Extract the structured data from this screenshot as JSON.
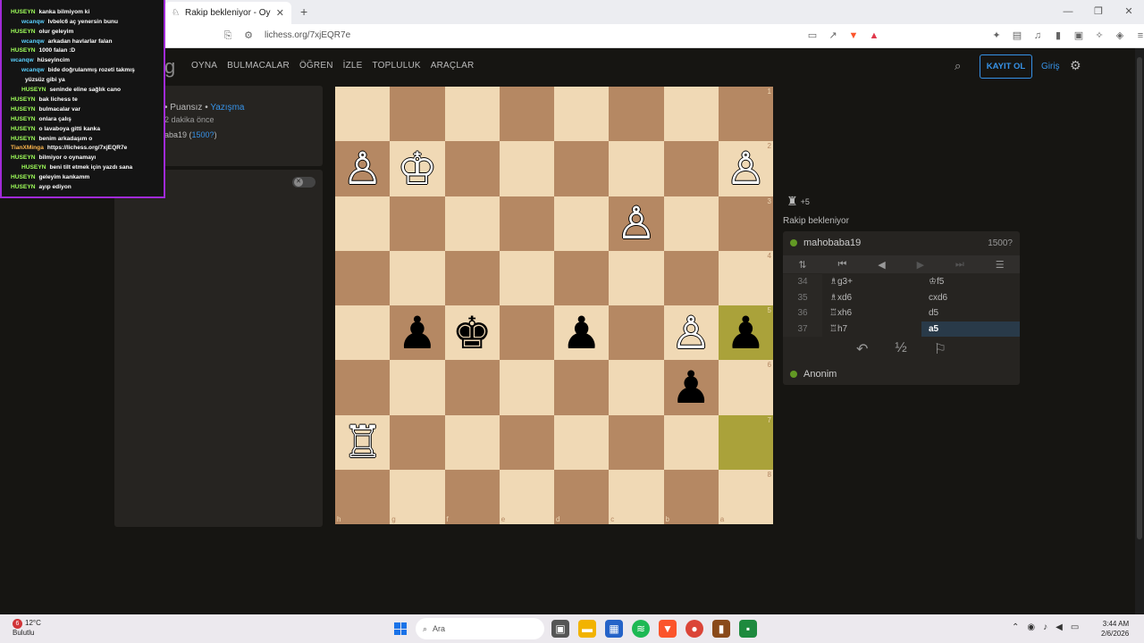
{
  "browser": {
    "tab_title": "Rakip bekleniyor - Oyna mah",
    "tab_close": "✕",
    "new_tab": "+",
    "url": "lichess.org/7xjEQR7e",
    "window_controls": [
      "—",
      "❐",
      "✕"
    ]
  },
  "site": {
    "logo_fragment": "g",
    "nav": [
      "OYNA",
      "BULMACALAR",
      "ÖĞREN",
      "İZLE",
      "TOPLULUK",
      "ARAÇLAR"
    ],
    "signup_label": "KAYIT OL",
    "signin_label": "Giriş"
  },
  "game_info": {
    "line1_prefix": "• Puansız •",
    "line1_link": "Yazışma",
    "line2": "2 dakika önce",
    "player_name": "aba19 (",
    "player_rating": "1500?",
    "player_close": ")"
  },
  "board": {
    "orientation": "black",
    "ranks": [
      "1",
      "2",
      "3",
      "4",
      "5",
      "6",
      "7",
      "8"
    ],
    "files": [
      "h",
      "g",
      "f",
      "e",
      "d",
      "c",
      "b",
      "a"
    ],
    "pieces": [
      [
        "",
        "",
        "",
        "",
        "",
        "",
        "",
        ""
      ],
      [
        "♙w",
        "♔w",
        "",
        "",
        "",
        "",
        "",
        "♙w"
      ],
      [
        "",
        "",
        "",
        "",
        "",
        "♙w",
        "",
        ""
      ],
      [
        "",
        "",
        "",
        "",
        "",
        "",
        "",
        ""
      ],
      [
        "",
        "♟b",
        "♚b",
        "",
        "♟b",
        "",
        "♙w",
        "♟b"
      ],
      [
        "",
        "",
        "",
        "",
        "",
        "",
        "♟b",
        ""
      ],
      [
        "♖w",
        "",
        "",
        "",
        "",
        "",
        "",
        ""
      ],
      [
        "",
        "",
        "",
        "",
        "",
        "",
        "",
        ""
      ]
    ],
    "highlights": [
      "4-7",
      "6-7"
    ]
  },
  "right_panel": {
    "material_diff": "+5",
    "status": "Rakip bekleniyor",
    "top_player": "mahobaba19",
    "top_rating": "1500?",
    "bottom_player": "Anonim",
    "moves": [
      {
        "num": "34",
        "white": "♗g3+",
        "black": "♔f5"
      },
      {
        "num": "35",
        "white": "♗xd6",
        "black": "cxd6"
      },
      {
        "num": "36",
        "white": "♖xh6",
        "black": "d5"
      },
      {
        "num": "37",
        "white": "♖h7",
        "black": "a5"
      }
    ],
    "action_half": "½"
  },
  "chat_overlay": [
    {
      "user": "HUSEYN",
      "color": "g",
      "text": "kanka bilmiyom ki"
    },
    {
      "user": "wcanqw",
      "color": "b",
      "text": "lvbelc6 aç yenersin bunu",
      "indent": true
    },
    {
      "user": "HUSEYN",
      "color": "g",
      "text": "olur geleyim"
    },
    {
      "user": "wcanqw",
      "color": "b",
      "text": "arkadan havlarlar falan",
      "indent": true
    },
    {
      "user": "HUSEYN",
      "color": "g",
      "text": "1000 falan :D"
    },
    {
      "user": "wcanqw",
      "color": "b",
      "text": "hüseyincim"
    },
    {
      "user": "wcanqw",
      "color": "b",
      "text": "bide doğrulanmış rozeti takmış",
      "indent": true
    },
    {
      "user": "",
      "color": "b",
      "text": "yüzsüz gibi ya",
      "indent": true
    },
    {
      "user": "HUSEYN",
      "color": "g",
      "text": "seninde eline sağlık cano",
      "indent": true
    },
    {
      "user": "HUSEYN",
      "color": "g",
      "text": "bak lichess te"
    },
    {
      "user": "HUSEYN",
      "color": "g",
      "text": "bulmacalar var"
    },
    {
      "user": "HUSEYN",
      "color": "g",
      "text": "onlara çalış"
    },
    {
      "user": "HUSEYN",
      "color": "g",
      "text": "o lavaboya gitti kanka"
    },
    {
      "user": "HUSEYN",
      "color": "g",
      "text": "benim arkadaşım o"
    },
    {
      "user": "TianXMinga",
      "color": "o",
      "text": "https://lichess.org/7xjEQR7e"
    },
    {
      "user": "HUSEYN",
      "color": "g",
      "text": "bilmiyor o oynamayı"
    },
    {
      "user": "HUSEYN",
      "color": "g",
      "text": "beni tilt etmek için yazdı sana",
      "indent": true
    },
    {
      "user": "HUSEYN",
      "color": "g",
      "text": "geleyim kankamm"
    },
    {
      "user": "HUSEYN",
      "color": "g",
      "text": "ayıp ediyon"
    }
  ],
  "taskbar": {
    "weather_badge": "6",
    "weather_temp": "12°C",
    "weather_desc": "Bulutlu",
    "search_placeholder": "Ara",
    "time": "3:44 AM",
    "date": "2/6/2026"
  },
  "colors": {
    "board_light": "#f0d9b5",
    "board_dark": "#b58863",
    "highlight": "#aaa23a",
    "accent_blue": "#3692e7",
    "overlay_border": "#a12ad8"
  }
}
